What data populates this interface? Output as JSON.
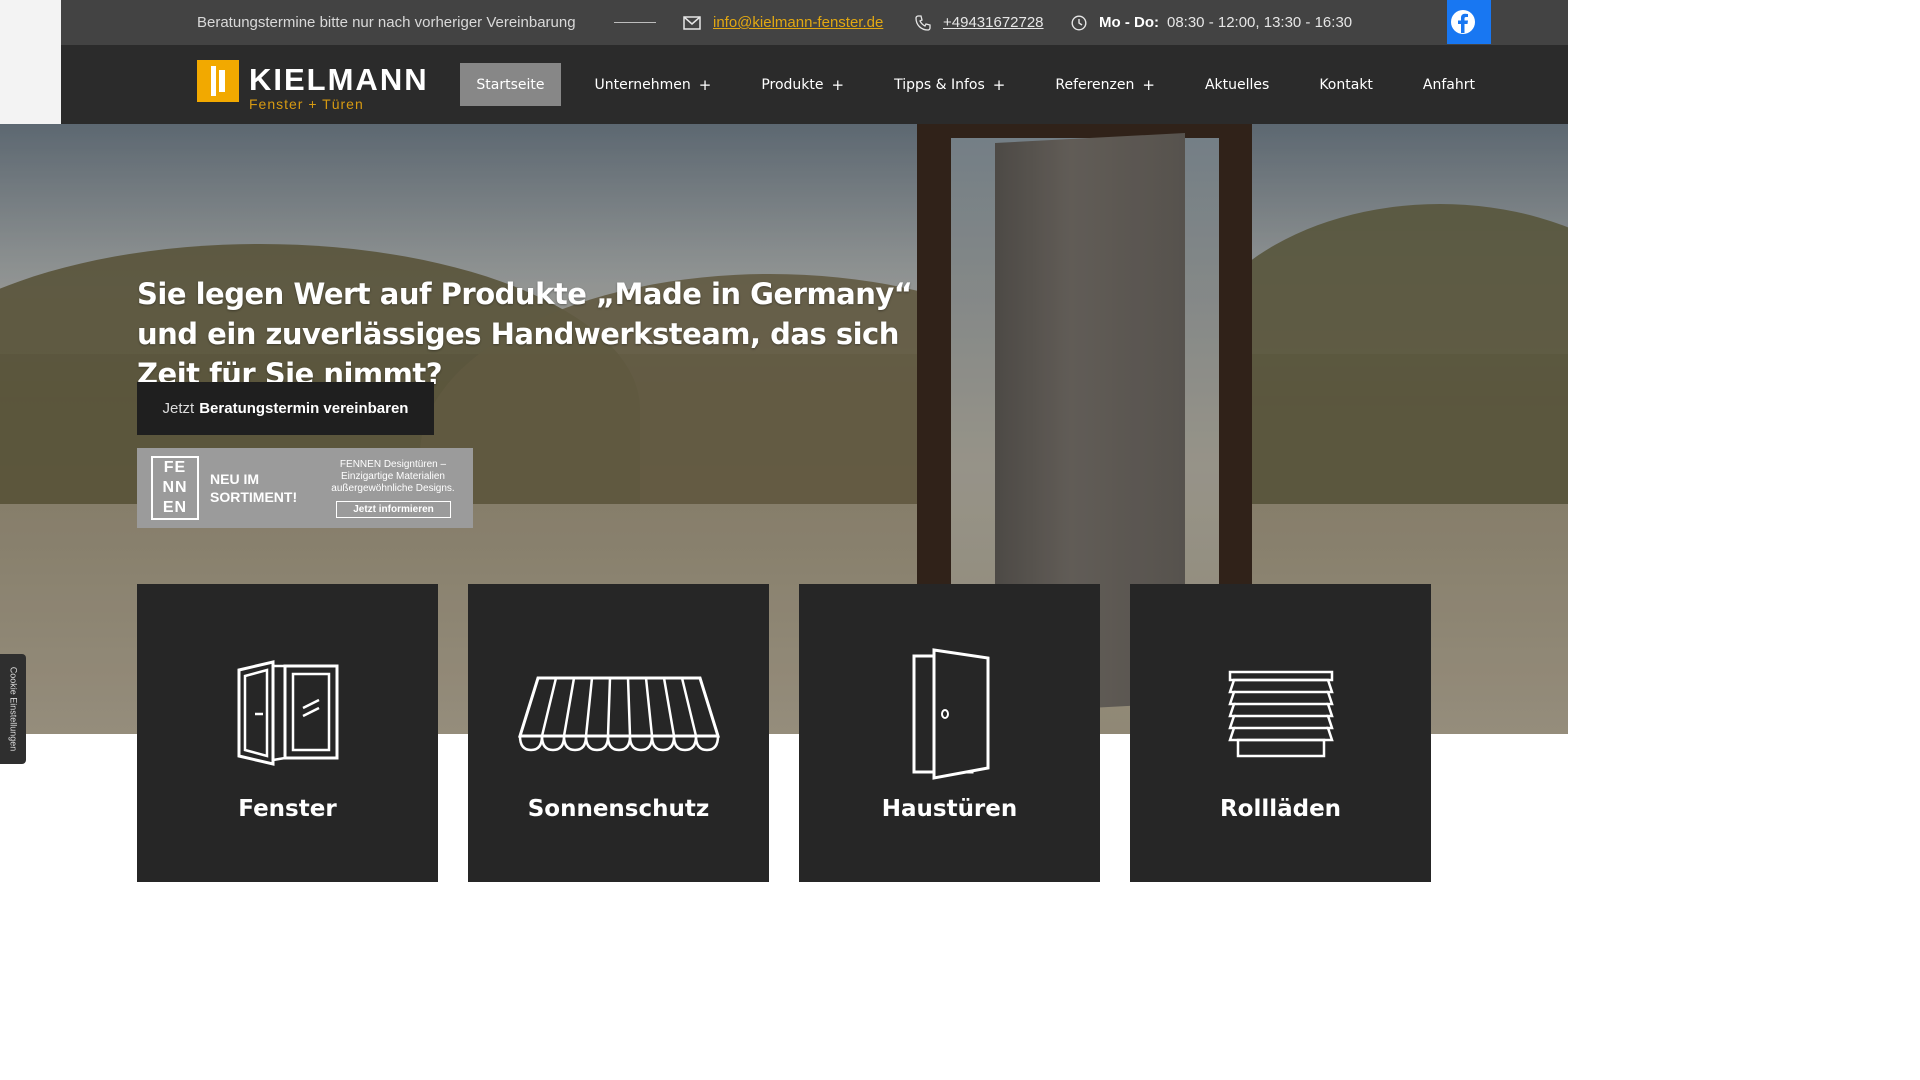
{
  "topbar": {
    "note": "Beratungstermine bitte nur nach vorheriger Vereinbarung",
    "email": "info@kielmann-fenster.de",
    "phone": "+49431672728",
    "hours_label": "Mo - Do:",
    "hours_value": "08:30 - 12:00, 13:30 - 16:30",
    "facebook_icon": "facebook-icon"
  },
  "brand": {
    "name": "KIELMANN",
    "tagline": "Fenster + Türen",
    "accent": "#f2a900"
  },
  "nav": {
    "items": [
      {
        "label": "Startseite",
        "active": true,
        "has_sub": false
      },
      {
        "label": "Unternehmen",
        "has_sub": true
      },
      {
        "label": "Produkte",
        "has_sub": true
      },
      {
        "label": "Tipps & Infos",
        "has_sub": true
      },
      {
        "label": "Referenzen",
        "has_sub": true
      },
      {
        "label": "Aktuelles",
        "has_sub": false
      },
      {
        "label": "Kontakt",
        "has_sub": false
      },
      {
        "label": "Anfahrt",
        "has_sub": false
      }
    ],
    "plus": "+"
  },
  "hero": {
    "headline": "Sie legen Wert auf Produkte „Made in Germany“ und ein zuverlässiges Handwerksteam, das sich Zeit für Sie nimmt?",
    "cta_pre": "Jetzt",
    "cta_main": "Beratungstermin vereinbaren"
  },
  "banner": {
    "mark": "FE NN EN",
    "headline": "NEU IM SORTIMENT!",
    "description": "FENNEN Designtüren – Einzigartige Materialien außergewöhnliche Designs.",
    "button": "Jetzt informieren"
  },
  "cards": [
    {
      "label": "Fenster",
      "icon": "window-icon"
    },
    {
      "label": "Sonnenschutz",
      "icon": "awning-icon"
    },
    {
      "label": "Haustüren",
      "icon": "front-door-icon"
    },
    {
      "label": "Rollläden",
      "icon": "roller-shutter-icon"
    }
  ],
  "cookie_button": "Cookie Einstellungen"
}
